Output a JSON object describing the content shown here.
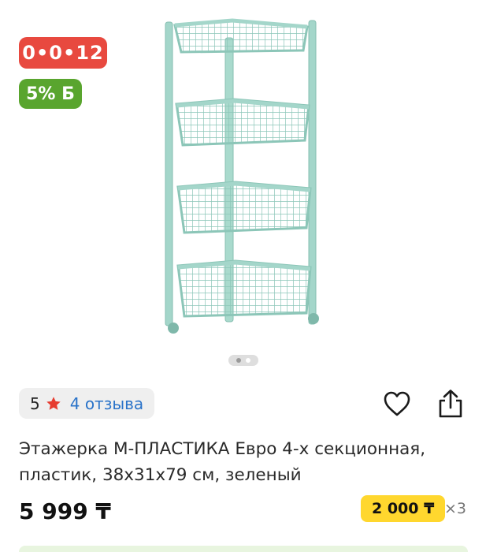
{
  "product": {
    "color": "#9fd3c7",
    "badges": {
      "countdown": "0•0•12",
      "bonus": "5% Б",
      "countdown_color": "#e8493f",
      "bonus_color": "#59a52e"
    },
    "gallery": {
      "current": 1,
      "total": 2
    },
    "rating": {
      "score": "5",
      "reviews_label": "4 отзыва",
      "star_icon": "star-icon"
    },
    "actions": {
      "favorite_icon": "heart-icon",
      "share_icon": "share-icon"
    },
    "title": "Этажерка М-ПЛАСТИКА Евро 4-х секционная, пластик, 38х31х79 см, зеленый",
    "price": "5 999 ₸",
    "installment": {
      "amount": "2 000 ₸",
      "multiplier": "×3",
      "color": "#ffd72e"
    }
  }
}
